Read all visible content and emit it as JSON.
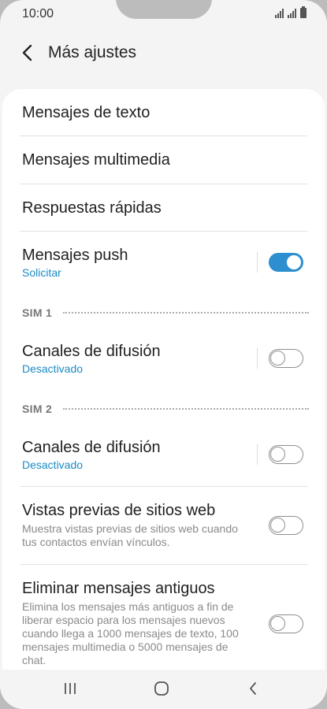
{
  "status_bar": {
    "time": "10:00"
  },
  "header": {
    "title": "Más ajustes"
  },
  "items": {
    "text_messages": {
      "label": "Mensajes de texto"
    },
    "multimedia_messages": {
      "label": "Mensajes multimedia"
    },
    "quick_responses": {
      "label": "Respuestas rápidas"
    },
    "push_messages": {
      "label": "Mensajes push",
      "sub": "Solicitar",
      "enabled": true
    }
  },
  "sim1": {
    "header": "SIM 1",
    "broadcast": {
      "label": "Canales de difusión",
      "sub": "Desactivado",
      "enabled": false
    }
  },
  "sim2": {
    "header": "SIM 2",
    "broadcast": {
      "label": "Canales de difusión",
      "sub": "Desactivado",
      "enabled": false
    }
  },
  "web_previews": {
    "label": "Vistas previas de sitios web",
    "desc": "Muestra vistas previas de sitios web cuando tus contactos envían vínculos.",
    "enabled": false
  },
  "delete_old": {
    "label": "Eliminar mensajes antiguos",
    "desc": "Elimina los mensajes más antiguos a fin de liberar espacio para los mensajes nuevos cuando llega a 1000 mensajes de texto, 100 mensajes multimedia o 5000 mensajes de chat.",
    "enabled": false
  },
  "colors": {
    "accent": "#2d8fcf",
    "sub_text": "#1a8bc4"
  },
  "icons": {
    "back": "chevron-left-icon",
    "nav_recents": "recents-icon",
    "nav_home": "home-icon",
    "nav_back": "back-icon"
  }
}
